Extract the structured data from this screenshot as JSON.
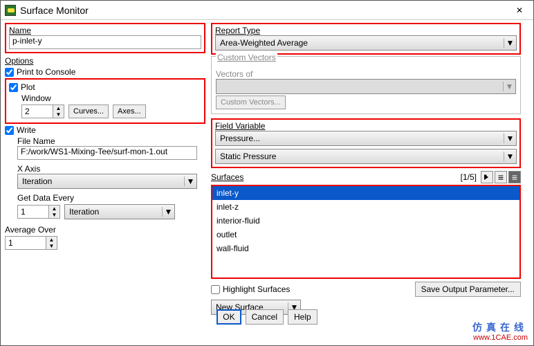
{
  "window": {
    "title": "Surface Monitor"
  },
  "name": {
    "label": "Name",
    "value": "p-inlet-y"
  },
  "options": {
    "header": "Options",
    "print": "Print to Console",
    "print_checked": true,
    "plot": "Plot",
    "plot_checked": true,
    "write": "Write",
    "write_checked": true
  },
  "plot": {
    "window_label": "Window",
    "window_val": "2",
    "curves_btn": "Curves...",
    "axes_btn": "Axes..."
  },
  "file": {
    "label": "File Name",
    "value": "F:/work/WS1-Mixing-Tee/surf-mon-1.out"
  },
  "xaxis": {
    "label": "X Axis",
    "value": "Iteration"
  },
  "getdata": {
    "label": "Get Data Every",
    "num": "1",
    "unit": "Iteration"
  },
  "avg": {
    "label": "Average Over",
    "num": "1"
  },
  "report": {
    "label": "Report Type",
    "value": "Area-Weighted Average"
  },
  "custom": {
    "label": "Custom Vectors",
    "vectors_of": "Vectors of",
    "btn": "Custom Vectors..."
  },
  "field": {
    "label": "Field Variable",
    "a": "Pressure...",
    "b": "Static Pressure"
  },
  "surfaces": {
    "label": "Surfaces",
    "count": "[1/5]",
    "items": [
      "inlet-y",
      "inlet-z",
      "interior-fluid",
      "outlet",
      "wall-fluid"
    ]
  },
  "highlight": "Highlight Surfaces",
  "save_out": "Save Output Parameter...",
  "new_surface": "New Surface",
  "buttons": {
    "ok": "OK",
    "cancel": "Cancel",
    "help": "Help"
  },
  "watermark": {
    "cn": "仿真在线",
    "url": "www.1CAE.com"
  }
}
